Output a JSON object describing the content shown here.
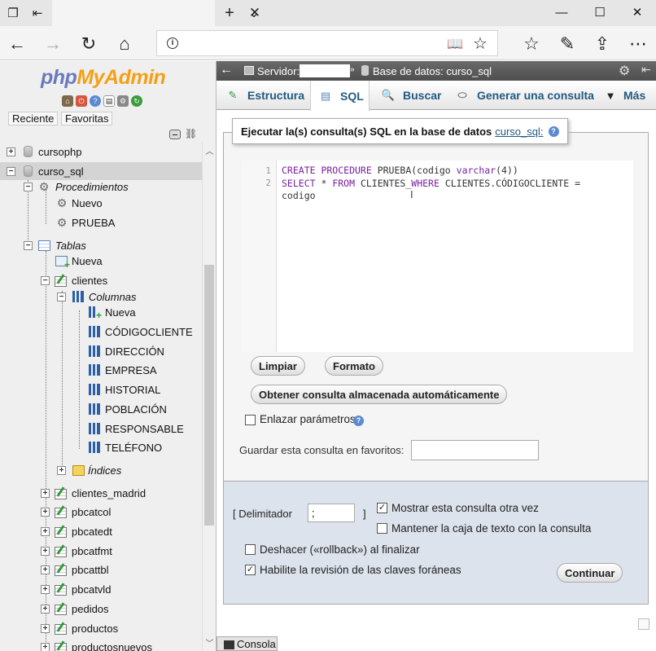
{
  "browser": {
    "url_value": ""
  },
  "sidebar": {
    "logo_php": "php",
    "logo_myadmin": "MyAdmin",
    "tab_recent": "Reciente",
    "tab_favorites": "Favoritas",
    "tree": {
      "db1": "cursophp",
      "db2": "curso_sql",
      "procedures": "Procedimientos",
      "proc_new": "Nuevo",
      "proc_prueba": "PRUEBA",
      "tables": "Tablas",
      "table_new": "Nueva",
      "table_clientes": "clientes",
      "columns": "Columnas",
      "col_new": "Nueva",
      "columns_list": [
        "CÓDIGOCLIENTE",
        "DIRECCIÓN",
        "EMPRESA",
        "HISTORIAL",
        "POBLACIÓN",
        "RESPONSABLE",
        "TELÉFONO"
      ],
      "indexes": "Índices",
      "tables_list": [
        "clientes_madrid",
        "pbcatcol",
        "pbcatedt",
        "pbcatfmt",
        "pbcattbl",
        "pbcatvld",
        "pedidos",
        "productos",
        "productosnuevos"
      ]
    }
  },
  "header": {
    "server_label": "Servidor:",
    "database_label": "Base de datos: curso_sql"
  },
  "tabs": {
    "structure": "Estructura",
    "sql": "SQL",
    "search": "Buscar",
    "query": "Generar una consulta",
    "more": "Más"
  },
  "sql_form": {
    "legend_text": "Ejecutar la(s) consulta(s) SQL en la base de datos",
    "legend_db": "curso_sql:",
    "code_line1": {
      "kw1": "CREATE PROCEDURE",
      "name": " PRUEBA(codigo ",
      "type": "varchar",
      "paren": "(4))"
    },
    "code_line2": {
      "kw1": "SELECT",
      "mid1": " * ",
      "kw2": "FROM",
      "mid2": " CLIENTES_",
      "kw3": "WHERE",
      "mid3": " CLIENTES.CÓDIGOCLIENTE =",
      "wrap": "codigo"
    },
    "clear_button": "Limpiar",
    "format_button": "Formato",
    "get_auto_saved_button": "Obtener consulta almacenada automáticamente",
    "bind_params_label": "Enlazar parámetros",
    "bookmark_label": "Guardar esta consulta en favoritos:",
    "bookmark_value": "",
    "delimiter_label": "[ Delimitador",
    "delimiter_value": ";",
    "delimiter_close": "]",
    "show_again_label": "Mostrar esta consulta otra vez",
    "retain_box_label": "Mantener la caja de texto con la consulta",
    "rollback_label": "Deshacer («rollback») al finalizar",
    "fk_checks_label": "Habilite la revisión de las claves foráneas",
    "go_button": "Continuar"
  },
  "console": {
    "label": "Consola"
  },
  "colors": {
    "accent": "#235a81",
    "logo_php": "#6b7abf",
    "logo_myadmin": "#f3a016",
    "keyword": "#7a1fa2",
    "function": "#2d7ab8"
  }
}
